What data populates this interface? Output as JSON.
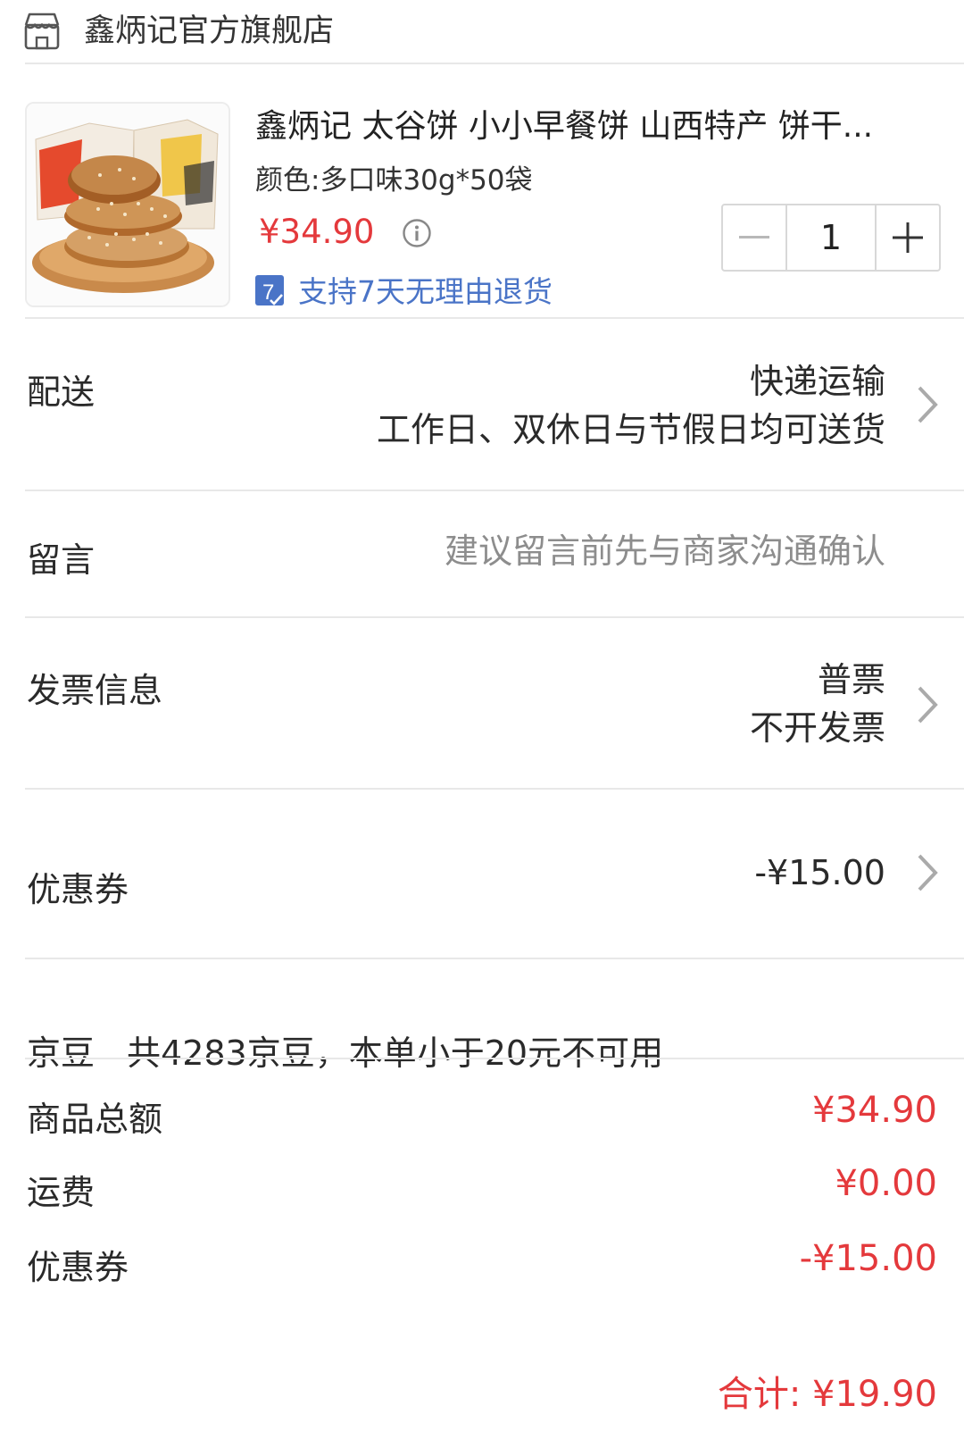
{
  "shop": {
    "icon": "store-icon",
    "name": "鑫炳记官方旗舰店"
  },
  "product": {
    "title": "鑫炳记 太谷饼 小小早餐饼 山西特产 饼干...",
    "spec": "颜色:多口味30g*50袋",
    "price": "¥34.90",
    "return_badge": "7",
    "return_policy": "支持7天无理由退货",
    "quantity": "1"
  },
  "delivery": {
    "label": "配送",
    "method": "快递运输",
    "schedule": "工作日、双休日与节假日均可送货"
  },
  "message": {
    "label": "留言",
    "placeholder": "建议留言前先与商家沟通确认"
  },
  "invoice": {
    "label": "发票信息",
    "type": "普票",
    "status": "不开发票"
  },
  "coupon": {
    "label": "优惠券",
    "value": "-¥15.00"
  },
  "jingdou": {
    "label": "京豆",
    "info": "共4283京豆，本单小于20元不可用"
  },
  "summary": {
    "items": [
      {
        "label": "商品总额",
        "value": "¥34.90"
      },
      {
        "label": "运费",
        "value": "¥0.00"
      },
      {
        "label": "优惠券",
        "value": "-¥15.00"
      }
    ],
    "total": "合计: ¥19.90"
  },
  "colors": {
    "accent": "#e4393c",
    "link": "#4a74c7",
    "divider": "#e8e8e8"
  }
}
